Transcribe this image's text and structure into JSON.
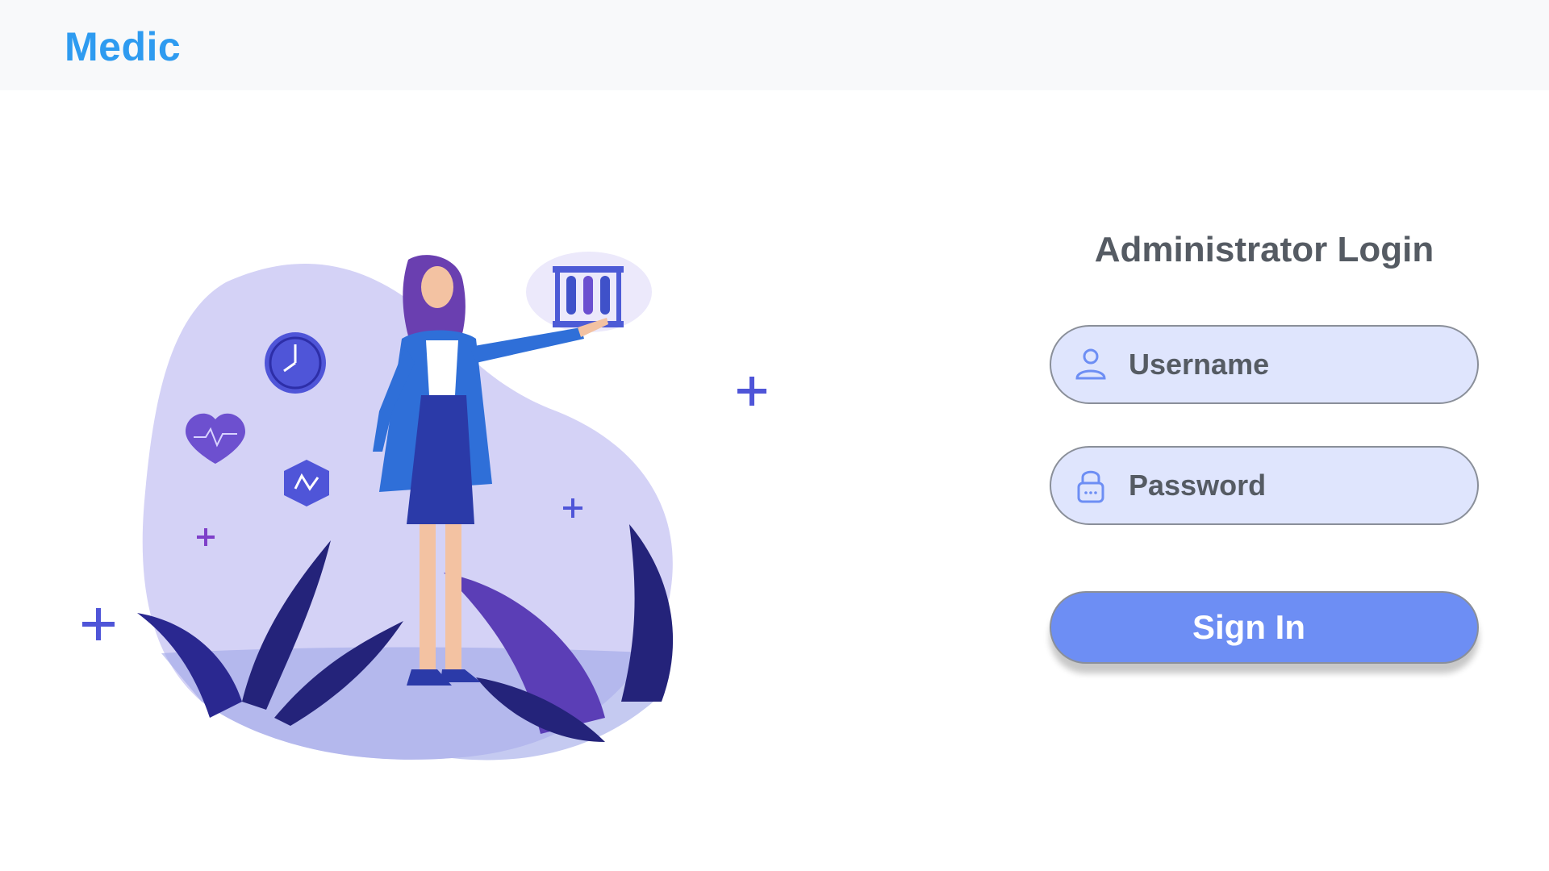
{
  "header": {
    "brand": "Medic"
  },
  "login": {
    "title": "Administrator Login",
    "username_placeholder": "Username",
    "password_placeholder": "Password",
    "signin_label": "Sign In"
  },
  "icons": {
    "username": "user-icon",
    "password": "lock-icon"
  },
  "colors": {
    "brand": "#2e9bf0",
    "field_bg": "#dfe5fd",
    "button_bg": "#6d8ef4",
    "illustration_blob": "#d4d2f6",
    "accent_purple": "#5a4fd6"
  }
}
